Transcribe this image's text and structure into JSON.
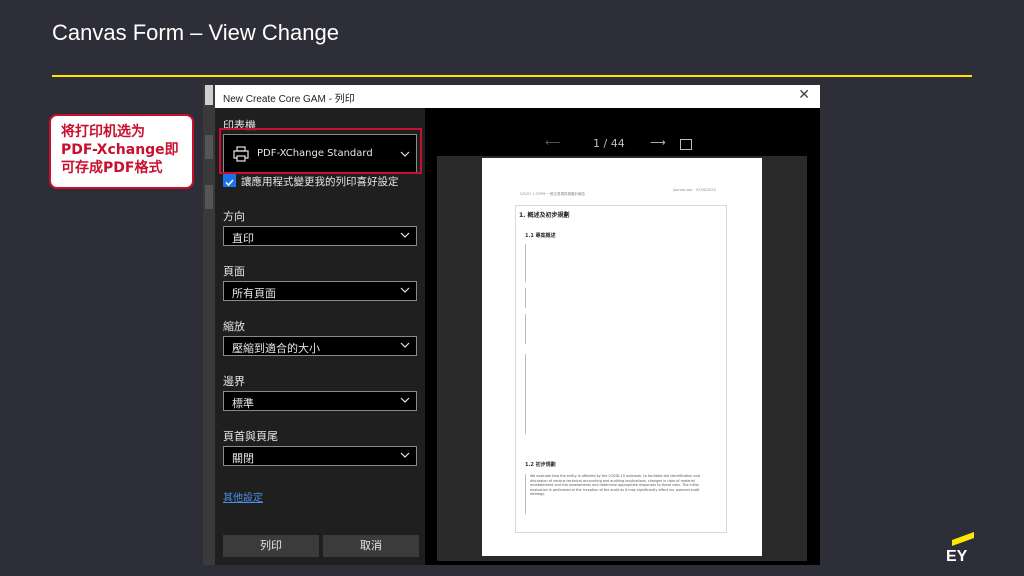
{
  "slide": {
    "title": "Canvas Form – View Change",
    "brand": "EY"
  },
  "colors": {
    "accent": "#ffe600",
    "callout": "#c8102e",
    "link": "#4a8fe7",
    "checkbox": "#1a73e8"
  },
  "callout": {
    "lines": [
      "将打印机选为",
      "PDF-Xchange即",
      "可存成PDF格式"
    ]
  },
  "dialog": {
    "title": "New Create Core GAM - 列印",
    "close_icon": "close-icon",
    "printer": {
      "label": "印表機",
      "value": "PDF-XChange Standard",
      "icon": "printer-icon"
    },
    "save_pref": {
      "label": "讓應用程式變更我的列印喜好設定",
      "checked": true
    },
    "orientation": {
      "label": "方向",
      "value": "直印"
    },
    "pages": {
      "label": "頁面",
      "value": "所有頁面"
    },
    "scale": {
      "label": "縮放",
      "value": "壓縮到適合的大小"
    },
    "margins": {
      "label": "邊界",
      "value": "標準"
    },
    "header_footer": {
      "label": "頁首與頁尾",
      "value": "關閉"
    },
    "more_settings": "其他設定",
    "print_button": "列印",
    "cancel_button": "取消",
    "pager": {
      "prev_icon": "arrow-left-icon",
      "text": "1 / 44",
      "next_icon": "arrow-right-icon",
      "fit_icon": "fit-page-icon"
    },
    "preview": {
      "header_left": "2/5/22 1:37PM 一般交易預算與審計報告",
      "header_right": "journal.doc · 07/02/2022",
      "h1": "1. 概述及初步規劃",
      "h1_1": "1.1 專案概述",
      "h1_2": "1.2 初步規劃",
      "para_en": "We evaluate how the entity is affected by the COVID-19 outbreak, to facilitate the identification and discussion of various technical accounting and auditing implications, changes in risks of material misstatement and risk assessments and determine appropriate responses to these risks. The initial evaluation is performed at the inception of the audit as it may significantly affect our planned audit strategy."
    }
  }
}
